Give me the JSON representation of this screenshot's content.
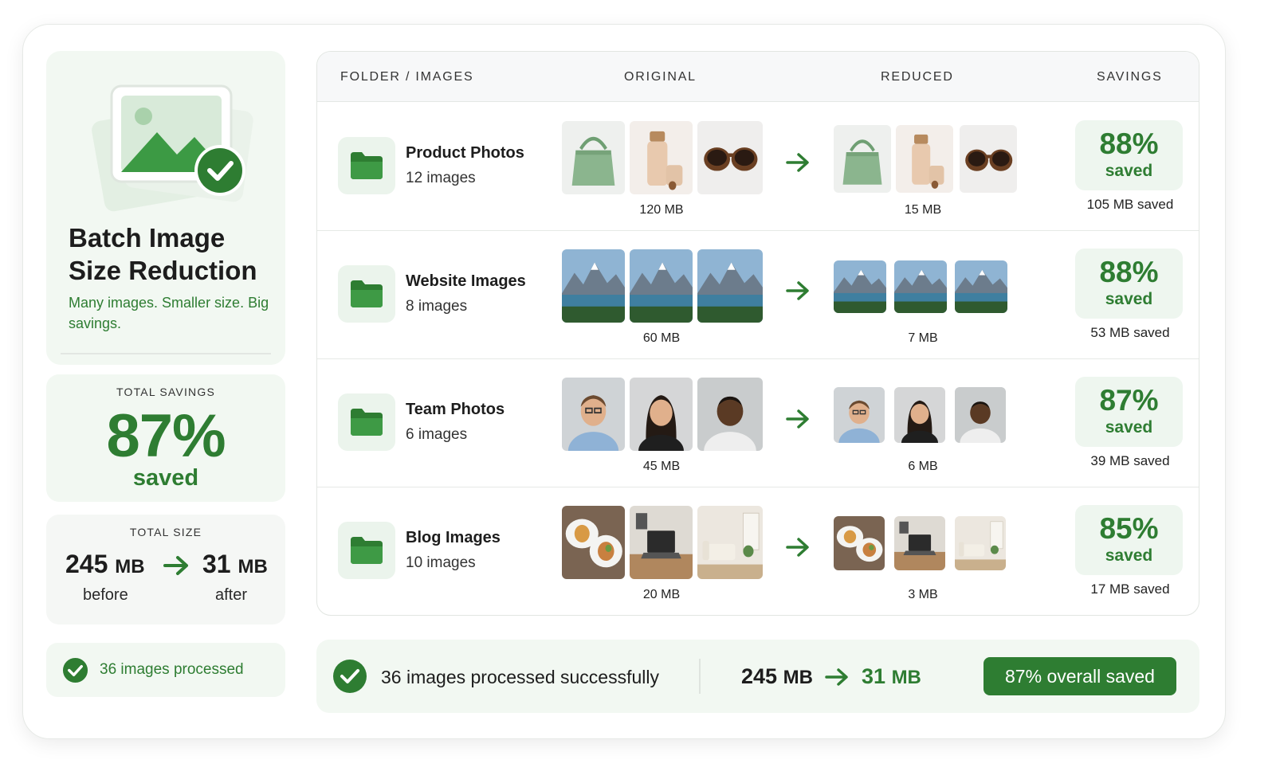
{
  "colors": {
    "accent": "#2e7d32",
    "accent_light": "#f2f8f2",
    "text": "#1d1d1d"
  },
  "sidebar": {
    "title": "Batch Image Size Reduction",
    "subtitle": "Many images. Smaller size. Big savings.",
    "hero_icon": "image-check-icon",
    "total_savings": {
      "label": "TOTAL SAVINGS",
      "percent": "87%",
      "suffix": "saved"
    },
    "total_size": {
      "label": "TOTAL SIZE",
      "before_value": "245",
      "before_unit": "MB",
      "before_label": "before",
      "after_value": "31",
      "after_unit": "MB",
      "after_label": "after"
    },
    "processed": "36 images processed"
  },
  "table": {
    "headers": {
      "folder": "FOLDER / IMAGES",
      "original": "ORIGINAL",
      "reduced": "REDUCED",
      "savings": "SAVINGS"
    },
    "rows": [
      {
        "name": "Product Photos",
        "count": "12 images",
        "original_size": "120 MB",
        "reduced_size": "15 MB",
        "percent": "88%",
        "saved_label": "saved",
        "mb_saved": "105 MB saved",
        "thumbs": [
          "handbag",
          "cosmetic-bottle",
          "sunglasses"
        ]
      },
      {
        "name": "Website Images",
        "count": "8 images",
        "original_size": "60 MB",
        "reduced_size": "7 MB",
        "percent": "88%",
        "saved_label": "saved",
        "mb_saved": "53 MB saved",
        "thumbs": [
          "mountain-lake",
          "mountain-lake",
          "mountain-lake"
        ]
      },
      {
        "name": "Team Photos",
        "count": "6 images",
        "original_size": "45 MB",
        "reduced_size": "6 MB",
        "percent": "87%",
        "saved_label": "saved",
        "mb_saved": "39 MB saved",
        "thumbs": [
          "portrait-man",
          "portrait-woman",
          "portrait-man-2"
        ]
      },
      {
        "name": "Blog Images",
        "count": "10 images",
        "original_size": "20 MB",
        "reduced_size": "3 MB",
        "percent": "85%",
        "saved_label": "saved",
        "mb_saved": "17 MB saved",
        "thumbs": [
          "food-plates",
          "laptop-desk",
          "living-room"
        ]
      }
    ]
  },
  "footer": {
    "status": "36 images processed successfully",
    "before": "245",
    "after": "31",
    "unit": "MB",
    "overall": "87% overall saved"
  }
}
